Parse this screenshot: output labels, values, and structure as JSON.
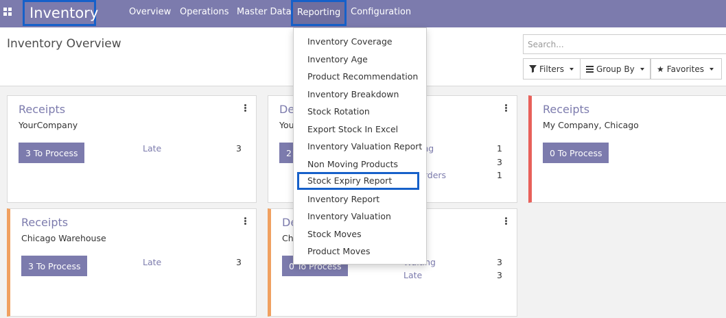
{
  "navbar": {
    "brand": "Inventory",
    "menu": {
      "overview": "Overview",
      "operations": "Operations",
      "master_data": "Master Data",
      "reporting": "Reporting",
      "configuration": "Configuration"
    },
    "accent_color": "#7c7bad",
    "highlight_color": "#1660c9"
  },
  "control_panel": {
    "title": "Inventory Overview",
    "search_placeholder": "Search...",
    "filters_label": "Filters",
    "groupby_label": "Group By",
    "favorites_label": "Favorites"
  },
  "reporting_menu": {
    "items": [
      "Inventory Coverage",
      "Inventory Age",
      "Product Recommendation",
      "Inventory Breakdown",
      "Stock Rotation",
      "Export Stock In Excel",
      "Inventory Valuation Report",
      "Non Moving Products",
      "Stock Expiry Report",
      "Inventory Report",
      "Inventory Valuation",
      "Stock Moves",
      "Product Moves"
    ],
    "highlighted_item": "Stock Expiry Report"
  },
  "cards": {
    "c1": {
      "title": "Receipts",
      "subtitle": "YourCompany",
      "button": "3 To Process",
      "stats": [
        {
          "label": "Late",
          "value": "3"
        }
      ]
    },
    "c2": {
      "title": "De",
      "subtitle": "You",
      "button": "2",
      "stats": [
        {
          "label": "ting",
          "value": "1"
        },
        {
          "label": "",
          "value": "3"
        },
        {
          "label": "Orders",
          "value": "1"
        }
      ]
    },
    "c3": {
      "title": "Receipts",
      "subtitle": "My Company, Chicago",
      "button": "0 To Process",
      "stats": []
    },
    "c4": {
      "title": "Receipts",
      "subtitle": "Chicago Warehouse",
      "button": "3 To Process",
      "stats": [
        {
          "label": "Late",
          "value": "3"
        }
      ]
    },
    "c5": {
      "title": "De",
      "subtitle": "Chi",
      "button": "0 To Process",
      "stats": [
        {
          "label": "Waiting",
          "value": "3"
        },
        {
          "label": "Late",
          "value": "3"
        }
      ]
    }
  }
}
